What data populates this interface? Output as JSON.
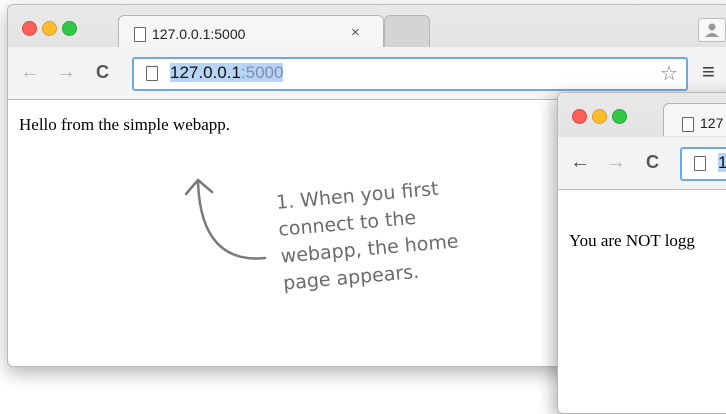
{
  "window_main": {
    "tab_title": "127.0.0.1:5000",
    "tab_close": "×",
    "url_host": "127.0.0.1",
    "url_port": ":5000",
    "page_text": "Hello from the simple webapp."
  },
  "window_second": {
    "tab_title": "127",
    "url_partial": "1",
    "page_text": "You are NOT logg"
  },
  "icons": {
    "back": "←",
    "forward": "→",
    "reload": "C",
    "star": "☆",
    "menu": "≡"
  },
  "annotation": {
    "lines": [
      "1. When you first",
      "connect to the",
      "webapp, the home",
      "page appears."
    ]
  }
}
